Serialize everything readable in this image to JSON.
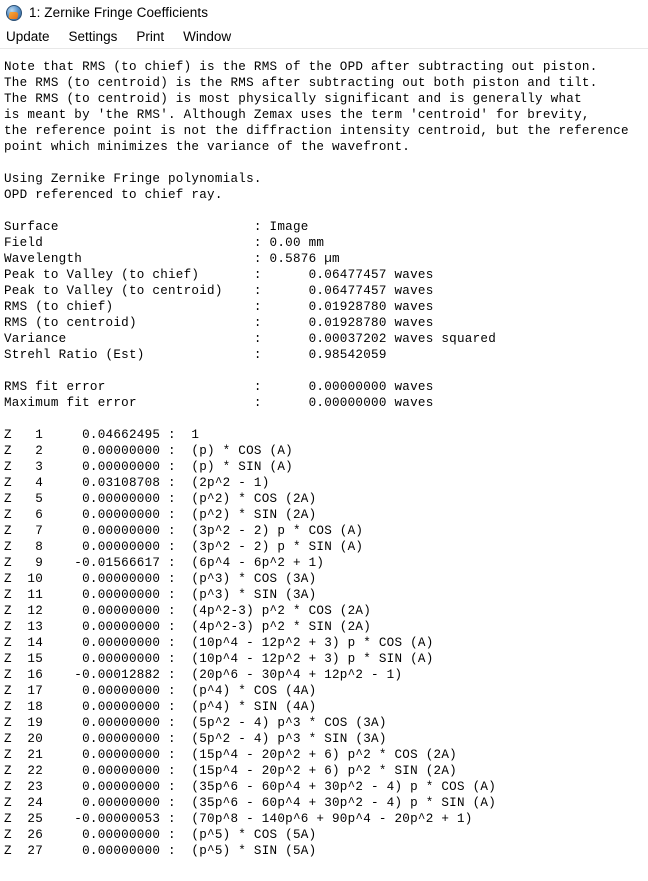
{
  "window": {
    "icon": "zemax-app-icon",
    "title": "1: Zernike Fringe Coefficients"
  },
  "menubar": {
    "items": [
      {
        "label": "Update"
      },
      {
        "label": "Settings"
      },
      {
        "label": "Print"
      },
      {
        "label": "Window"
      }
    ]
  },
  "report": {
    "notes": [
      "Note that RMS (to chief) is the RMS of the OPD after subtracting out piston.",
      "The RMS (to centroid) is the RMS after subtracting out both piston and tilt.",
      "The RMS (to centroid) is most physically significant and is generally what",
      "is meant by 'the RMS'. Although Zemax uses the term 'centroid' for brevity,",
      "the reference point is not the diffraction intensity centroid, but the reference",
      "point which minimizes the variance of the wavefront."
    ],
    "method": [
      "Using Zernike Fringe polynomials.",
      "OPD referenced to chief ray."
    ],
    "summary": [
      {
        "label": "Surface",
        "value": "Image",
        "units": ""
      },
      {
        "label": "Field",
        "value": "0.00",
        "units": "mm"
      },
      {
        "label": "Wavelength",
        "value": "0.5876",
        "units": "µm"
      },
      {
        "label": "Peak to Valley (to chief)",
        "value": "0.06477457",
        "units": "waves"
      },
      {
        "label": "Peak to Valley (to centroid)",
        "value": "0.06477457",
        "units": "waves"
      },
      {
        "label": "RMS (to chief)",
        "value": "0.01928780",
        "units": "waves"
      },
      {
        "label": "RMS (to centroid)",
        "value": "0.01928780",
        "units": "waves"
      },
      {
        "label": "Variance",
        "value": "0.00037202",
        "units": "waves squared"
      },
      {
        "label": "Strehl Ratio (Est)",
        "value": "0.98542059",
        "units": ""
      }
    ],
    "fit_errors": [
      {
        "label": "RMS fit error",
        "value": "0.00000000",
        "units": "waves"
      },
      {
        "label": "Maximum fit error",
        "value": "0.00000000",
        "units": "waves"
      }
    ],
    "coefficients": [
      {
        "index": "1",
        "value": "0.04662495",
        "term": "1"
      },
      {
        "index": "2",
        "value": "0.00000000",
        "term": "(p) * COS (A)"
      },
      {
        "index": "3",
        "value": "0.00000000",
        "term": "(p) * SIN (A)"
      },
      {
        "index": "4",
        "value": "0.03108708",
        "term": "(2p^2 - 1)"
      },
      {
        "index": "5",
        "value": "0.00000000",
        "term": "(p^2) * COS (2A)"
      },
      {
        "index": "6",
        "value": "0.00000000",
        "term": "(p^2) * SIN (2A)"
      },
      {
        "index": "7",
        "value": "0.00000000",
        "term": "(3p^2 - 2) p * COS (A)"
      },
      {
        "index": "8",
        "value": "0.00000000",
        "term": "(3p^2 - 2) p * SIN (A)"
      },
      {
        "index": "9",
        "value": "-0.01566617",
        "term": "(6p^4 - 6p^2 + 1)"
      },
      {
        "index": "10",
        "value": "0.00000000",
        "term": "(p^3) * COS (3A)"
      },
      {
        "index": "11",
        "value": "0.00000000",
        "term": "(p^3) * SIN (3A)"
      },
      {
        "index": "12",
        "value": "0.00000000",
        "term": "(4p^2-3) p^2 * COS (2A)"
      },
      {
        "index": "13",
        "value": "0.00000000",
        "term": "(4p^2-3) p^2 * SIN (2A)"
      },
      {
        "index": "14",
        "value": "0.00000000",
        "term": "(10p^4 - 12p^2 + 3) p * COS (A)"
      },
      {
        "index": "15",
        "value": "0.00000000",
        "term": "(10p^4 - 12p^2 + 3) p * SIN (A)"
      },
      {
        "index": "16",
        "value": "-0.00012882",
        "term": "(20p^6 - 30p^4 + 12p^2 - 1)"
      },
      {
        "index": "17",
        "value": "0.00000000",
        "term": "(p^4) * COS (4A)"
      },
      {
        "index": "18",
        "value": "0.00000000",
        "term": "(p^4) * SIN (4A)"
      },
      {
        "index": "19",
        "value": "0.00000000",
        "term": "(5p^2 - 4) p^3 * COS (3A)"
      },
      {
        "index": "20",
        "value": "0.00000000",
        "term": "(5p^2 - 4) p^3 * SIN (3A)"
      },
      {
        "index": "21",
        "value": "0.00000000",
        "term": "(15p^4 - 20p^2 + 6) p^2 * COS (2A)"
      },
      {
        "index": "22",
        "value": "0.00000000",
        "term": "(15p^4 - 20p^2 + 6) p^2 * SIN (2A)"
      },
      {
        "index": "23",
        "value": "0.00000000",
        "term": "(35p^6 - 60p^4 + 30p^2 - 4) p * COS (A)"
      },
      {
        "index": "24",
        "value": "0.00000000",
        "term": "(35p^6 - 60p^4 + 30p^2 - 4) p * SIN (A)"
      },
      {
        "index": "25",
        "value": "-0.00000053",
        "term": "(70p^8 - 140p^6 + 90p^4 - 20p^2 + 1)"
      },
      {
        "index": "26",
        "value": "0.00000000",
        "term": "(p^5) * COS (5A)"
      },
      {
        "index": "27",
        "value": "0.00000000",
        "term": "(p^5) * SIN (5A)"
      }
    ]
  }
}
